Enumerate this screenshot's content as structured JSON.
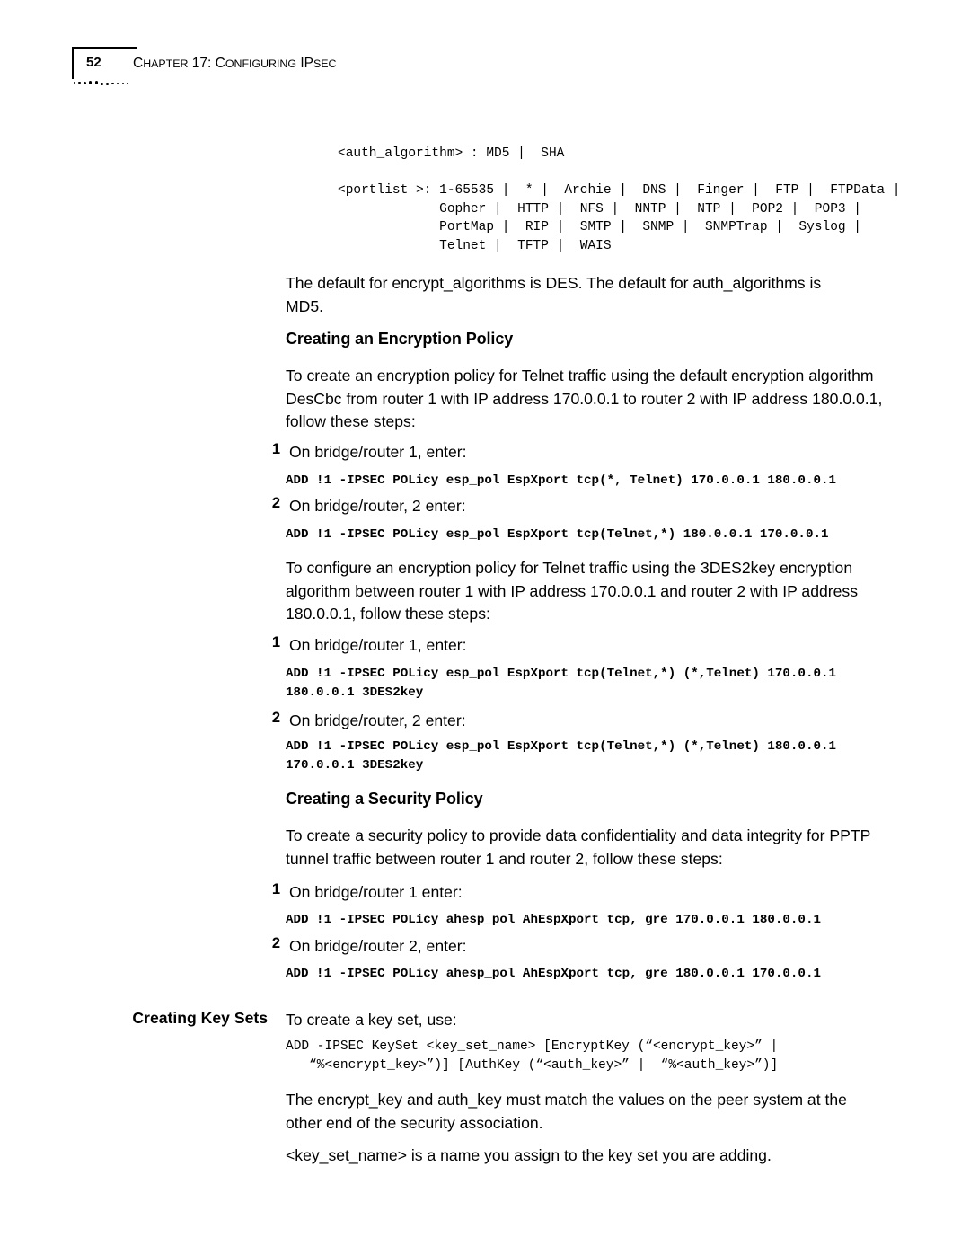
{
  "page": {
    "number": "52",
    "chapter_prefix": "C",
    "chapter_title_sc": "HAPTER ",
    "chapter_title_full": "CHAPTER 17: CONFIGURING IPSEC",
    "chapter_head": "C",
    "chapter_rest": "HAPTER 17: C",
    "chapter_rest2": "ONFIGURING ",
    "chapter_ip": "IP",
    "chapter_sec": "SEC"
  },
  "syntax_blocks": {
    "auth_algorithm": "<auth_algorithm> : MD5 |  SHA",
    "portlist": "<portlist >: 1-65535 |  * |  Archie |  DNS |  Finger |  FTP |  FTPData |\n             Gopher |  HTTP |  NFS |  NNTP |  NTP |  POP2 |  POP3 |\n             PortMap |  RIP |  SMTP |  SNMP |  SNMPTrap |  Syslog |\n             Telnet |  TFTP |  WAIS",
    "keyset": "ADD -IPSEC KeySet <key_set_name> [EncryptKey (“<encrypt_key>” |\n   “%<encrypt_key>”)] [AuthKey (“<auth_key>” |  “%<auth_key>”)]"
  },
  "paragraphs": {
    "defaults": "The default for encrypt_algorithms is DES. The default for auth_algorithms is MD5.",
    "encryption_intro": "To create an encryption policy for Telnet traffic using the default encryption algorithm DesCbc from router 1 with IP address 170.0.0.1 to router 2 with IP address 180.0.0.1, follow these steps:",
    "threedes_intro": "To configure an encryption policy for Telnet traffic using the 3DES2key encryption algorithm between router 1 with IP address 170.0.0.1 and router 2 with IP address 180.0.0.1, follow these steps:",
    "security_intro": "To create a security policy to provide data confidentiality and data integrity for PPTP tunnel traffic between router 1 and router 2, follow these steps:",
    "keyset_intro": "To create a key set, use:",
    "keys_match": "The encrypt_key and auth_key must match the values on the peer system at the other end of the security association.",
    "keysetname_note": "<key_set_name> is a name you assign to the key set you are adding."
  },
  "headings": {
    "encryption_policy": "Creating an Encryption Policy",
    "security_policy": "Creating a Security Policy",
    "key_sets": "Creating Key Sets"
  },
  "steps": {
    "enc_1_num": "1",
    "enc_1_text": "On bridge/router 1, enter:",
    "enc_1_cmd": "ADD !1 -IPSEC POLicy esp_pol EspXport tcp(*, Telnet) 170.0.0.1 180.0.0.1",
    "enc_2_num": "2",
    "enc_2_text": "On bridge/router, 2 enter:",
    "enc_2_cmd": "ADD !1 -IPSEC POLicy esp_pol EspXport tcp(Telnet,*) 180.0.0.1 170.0.0.1",
    "des3_1_num": "1",
    "des3_1_text": "On bridge/router 1, enter:",
    "des3_1_cmd": "ADD !1 -IPSEC POLicy esp_pol EspXport tcp(Telnet,*) (*,Telnet) 170.0.0.1\n180.0.0.1 3DES2key",
    "des3_2_num": "2",
    "des3_2_text": "On bridge/router, 2 enter:",
    "des3_2_cmd": "ADD !1 -IPSEC POLicy esp_pol EspXport tcp(Telnet,*) (*,Telnet) 180.0.0.1\n170.0.0.1 3DES2key",
    "sec_1_num": "1",
    "sec_1_text": "On bridge/router 1 enter:",
    "sec_1_cmd": "ADD !1 -IPSEC POLicy ahesp_pol AhEspXport tcp, gre 170.0.0.1 180.0.0.1",
    "sec_2_num": "2",
    "sec_2_text": "On bridge/router 2, enter:",
    "sec_2_cmd": "ADD !1 -IPSEC POLicy ahesp_pol AhEspXport tcp, gre 180.0.0.1 170.0.0.1"
  }
}
